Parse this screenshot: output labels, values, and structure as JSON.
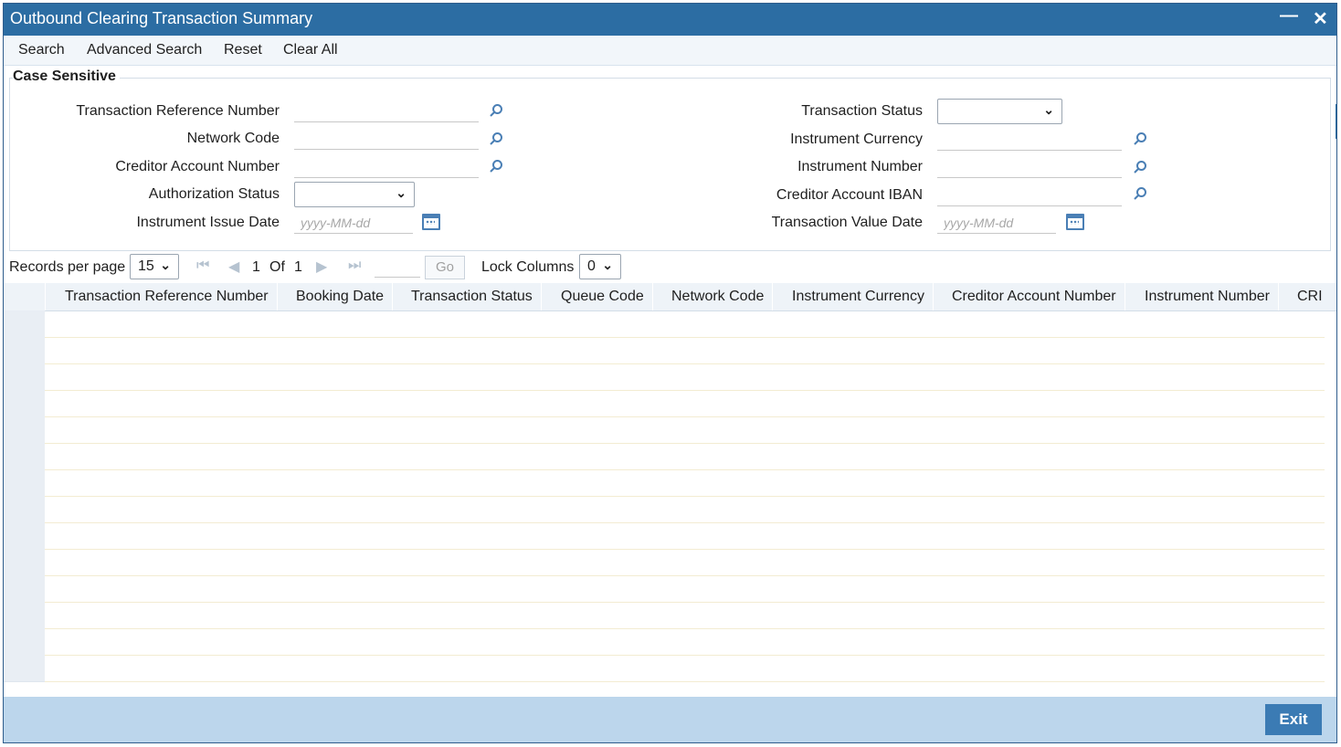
{
  "window": {
    "title": "Outbound Clearing Transaction Summary"
  },
  "menu": [
    "Search",
    "Advanced Search",
    "Reset",
    "Clear All"
  ],
  "criteria": {
    "legend": "Case Sensitive",
    "left": [
      {
        "label": "Transaction Reference Number",
        "type": "lookup"
      },
      {
        "label": "Network Code",
        "type": "lookup"
      },
      {
        "label": "Creditor Account Number",
        "type": "lookup"
      },
      {
        "label": "Authorization Status",
        "type": "select",
        "value": ""
      },
      {
        "label": "Instrument Issue Date",
        "type": "date",
        "placeholder": "yyyy-MM-dd"
      }
    ],
    "right": [
      {
        "label": "Transaction Status",
        "type": "select",
        "value": ""
      },
      {
        "label": "Instrument Currency",
        "type": "lookup"
      },
      {
        "label": "Instrument Number",
        "type": "lookup"
      },
      {
        "label": "Creditor Account IBAN",
        "type": "lookup"
      },
      {
        "label": "Transaction Value Date",
        "type": "date",
        "placeholder": "yyyy-MM-dd"
      }
    ]
  },
  "pager": {
    "records_label": "Records per page",
    "records_value": "15",
    "current_page": "1",
    "of_label": "Of",
    "total_pages": "1",
    "go_label": "Go",
    "lock_label": "Lock Columns",
    "lock_value": "0"
  },
  "grid": {
    "columns": [
      "Transaction Reference Number",
      "Booking Date",
      "Transaction Status",
      "Queue Code",
      "Network Code",
      "Instrument Currency",
      "Creditor Account Number",
      "Instrument Number",
      "CRI"
    ],
    "row_count": 14
  },
  "footer": {
    "exit_label": "Exit"
  },
  "colors": {
    "title_bar": "#2c6da3",
    "footer": "#bcd6ec",
    "exit_button": "#3b7bb4",
    "icon": "#4a7fb5"
  }
}
